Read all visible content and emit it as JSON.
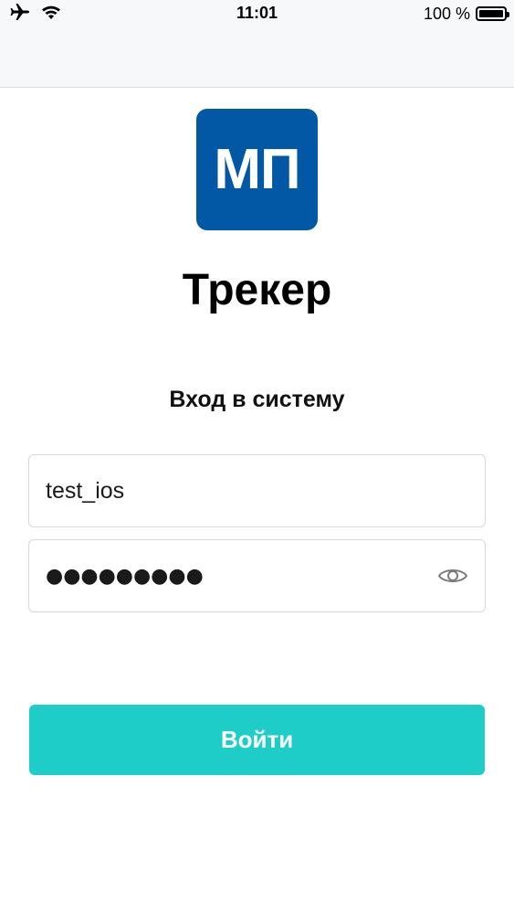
{
  "status_bar": {
    "time": "11:01",
    "battery_text": "100 %",
    "battery_level": 1.0,
    "icons": [
      "airplane-icon",
      "wifi-icon",
      "battery-icon"
    ]
  },
  "logo": {
    "text": "МП",
    "color": "#0358a5"
  },
  "app": {
    "title": "Трекер"
  },
  "login_form": {
    "heading": "Вход в систему",
    "login_value": "test_ios",
    "password_masked": "●●●●●●●●●",
    "submit_label": "Войти",
    "accent_color": "#1ecdc8"
  }
}
